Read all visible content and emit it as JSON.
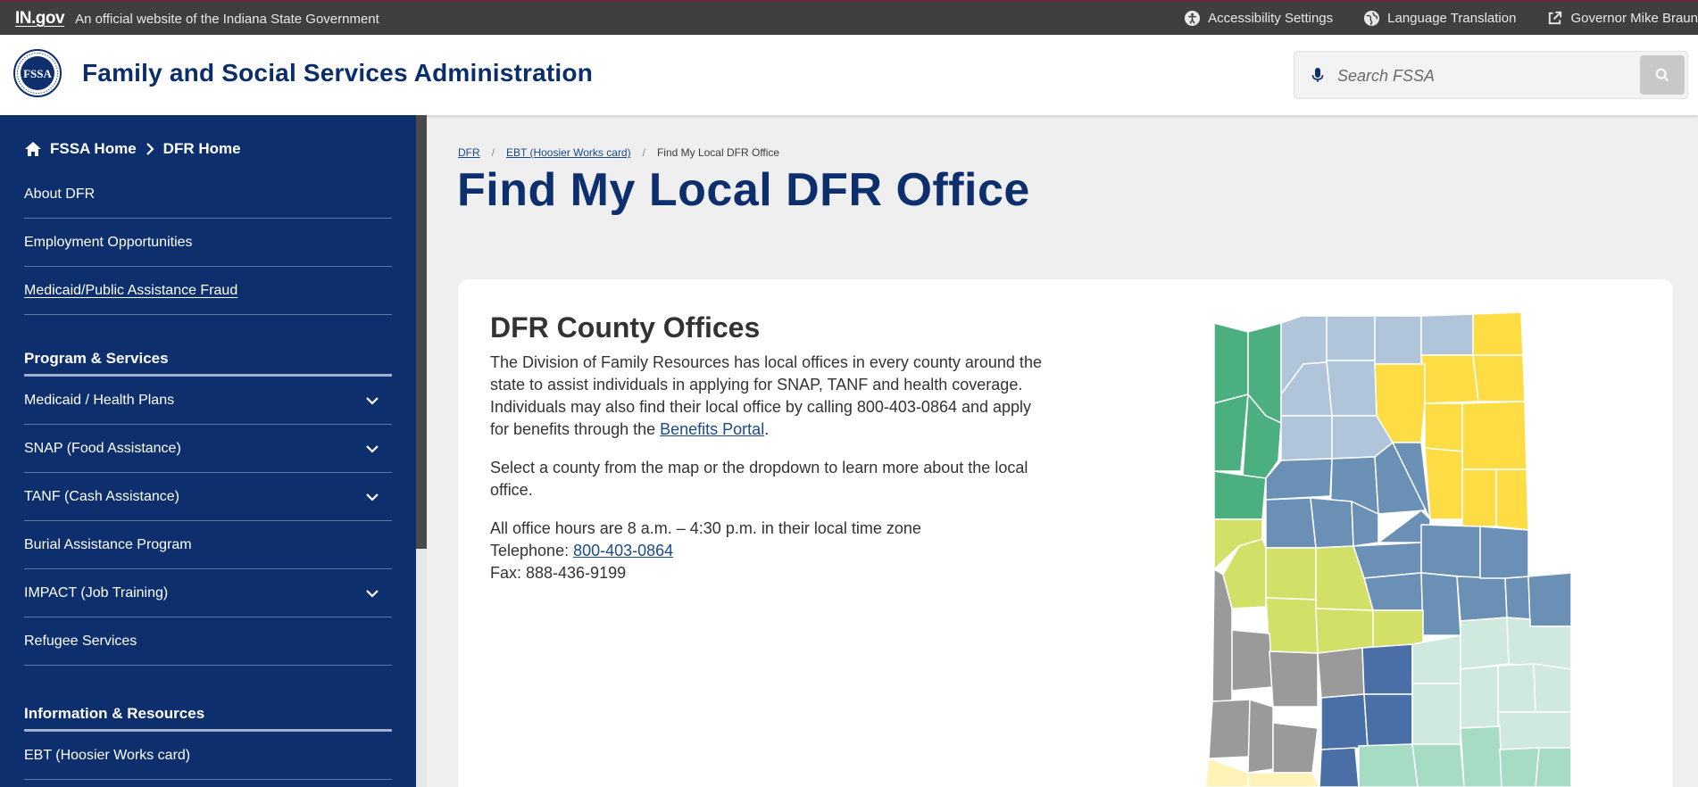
{
  "topbar": {
    "logo": "IN.gov",
    "official": "An official website of the Indiana State Government",
    "links": [
      {
        "label": "Accessibility Settings",
        "icon": "accessibility-icon"
      },
      {
        "label": "Language Translation",
        "icon": "globe-icon"
      },
      {
        "label": "Governor Mike Braun",
        "icon": "external-link-icon"
      }
    ]
  },
  "header": {
    "title": "Family and Social Services Administration",
    "seal_text": "FSSA",
    "search_placeholder": "Search FSSA"
  },
  "sidebar": {
    "crumb_home": "FSSA Home",
    "crumb_current": "DFR Home",
    "items": [
      {
        "label": "About DFR"
      },
      {
        "label": "Employment Opportunities"
      },
      {
        "label": "Medicaid/Public Assistance Fraud"
      }
    ],
    "section_programs": "Program & Services",
    "programs": [
      {
        "label": "Medicaid / Health Plans"
      },
      {
        "label": "SNAP (Food Assistance)"
      },
      {
        "label": "TANF (Cash Assistance)"
      },
      {
        "label": "Burial Assistance Program"
      },
      {
        "label": "IMPACT (Job Training)"
      },
      {
        "label": "Refugee Services"
      }
    ],
    "section_info": "Information & Resources",
    "info": [
      {
        "label": "EBT (Hoosier Works card)"
      }
    ]
  },
  "breadcrumb": {
    "items": [
      "DFR",
      "EBT (Hoosier Works card)"
    ],
    "current": "Find My Local DFR Office",
    "sep": "/"
  },
  "main": {
    "title": "Find My Local DFR Office",
    "card_title": "DFR County Offices",
    "p1_before": "The Division of Family Resources has local offices in every county around the state to assist individuals in applying for SNAP, TANF and health coverage. Individuals may also find their local office by calling 800-403-0864 and apply for benefits through the ",
    "p1_link": "Benefits Portal",
    "p1_after": ".",
    "p2": "Select a county from the map or the dropdown to learn more about the local office.",
    "hours": "All office hours are 8 a.m. – 4:30 p.m. in their local time zone",
    "tel_label": "Telephone: ",
    "tel": "800-403-0864",
    "fax": "Fax: 888-436-9199"
  },
  "colors": {
    "navy": "#0d2f6e",
    "green": "#4caf80",
    "lightblue": "#b0c4da",
    "yellow": "#fddc44",
    "steel": "#6b90b5",
    "lime": "#d3e067",
    "gray": "#9a9a9a",
    "darkblue": "#4a6ea6",
    "mint": "#cfe9df",
    "seafoam": "#a6dcc4",
    "cream": "#fff3b8"
  }
}
